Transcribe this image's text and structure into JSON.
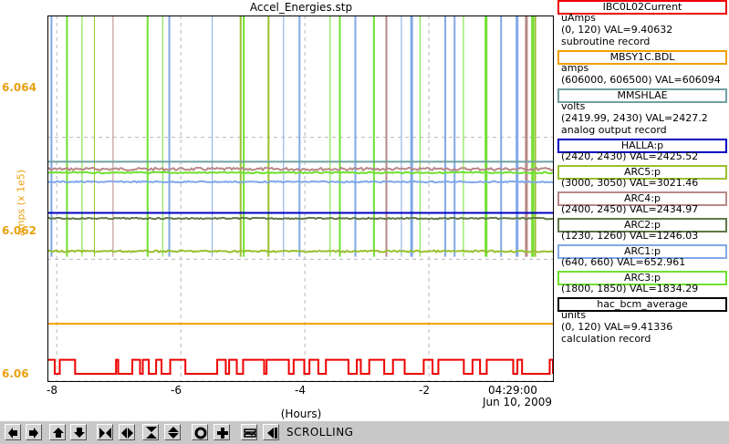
{
  "window": {
    "title": "Accel_Energies.stp"
  },
  "plot": {
    "y_axis_label": "amps (x 1e5)",
    "y_ticks": [
      "6.064",
      "6.062",
      "6.06"
    ],
    "x_ticks": [
      "-8",
      "-6",
      "-4",
      "-2"
    ],
    "x_time_label": "04:29:00",
    "x_date_label": "Jun 10, 2009",
    "x_axis_label": "(Hours)",
    "axis_color": "#e8a010"
  },
  "legend": [
    {
      "name": "IBC0L02Current",
      "color": "#ee0000",
      "lines": [
        "uAmps",
        "(0, 120) VAL=9.40632",
        "subroutine record"
      ]
    },
    {
      "name": "MBSY1C.BDL",
      "color": "#f0a000",
      "lines": [
        "amps",
        "(606000, 606500) VAL=606094"
      ]
    },
    {
      "name": "MMSHLAE",
      "color": "#70a0a0",
      "lines": [
        "volts",
        "(2419.99, 2430) VAL=2427.2",
        "analog output record"
      ]
    },
    {
      "name": "HALLA:p",
      "color": "#0000c0",
      "lines": [
        "(2420, 2430) VAL=2425.52"
      ]
    },
    {
      "name": "ARC5:p",
      "color": "#98c030",
      "lines": [
        "(3000, 3050) VAL=3021.46"
      ]
    },
    {
      "name": "ARC4:p",
      "color": "#b88888",
      "lines": [
        "(2400, 2450) VAL=2434.97"
      ]
    },
    {
      "name": "ARC2:p",
      "color": "#607848",
      "lines": [
        "(1230, 1260) VAL=1246.03"
      ]
    },
    {
      "name": "ARC1:p",
      "color": "#80a8e8",
      "lines": [
        "(640, 660) VAL=652.961"
      ]
    },
    {
      "name": "ARC3:p",
      "color": "#70e030",
      "lines": [
        "(1800, 1850) VAL=1834.29"
      ]
    },
    {
      "name": "hac_bcm_average",
      "color": "#000000",
      "lines": [
        "units",
        "(0, 120) VAL=9.41336",
        "calculation record"
      ]
    }
  ],
  "toolbar": {
    "buttons": [
      "pan-left-icon",
      "pan-right-icon",
      "pan-up-icon",
      "pan-down-icon",
      "zoom-in-x-icon",
      "zoom-out-x-icon",
      "zoom-in-y-icon",
      "zoom-out-y-icon",
      "auto-scale-icon",
      "reset-zoom-icon",
      "scroll-toggle-icon",
      "jump-to-end-icon"
    ],
    "mode_label": "SCROLLING"
  },
  "chart_data": {
    "type": "line",
    "title": "Accel_Energies.stp",
    "xlabel": "(Hours)",
    "ylabel": "amps (x 1e5)",
    "xlim": [
      -8.15,
      0
    ],
    "ylim": [
      6.06,
      6.066
    ],
    "x_ticks": [
      -8,
      -6,
      -4,
      -2
    ],
    "y_ticks": [
      6.06,
      6.062,
      6.064
    ],
    "grid": true,
    "series": [
      {
        "name": "MBSY1C.BDL",
        "color": "#f0a000",
        "values": [
          [
            -8.15,
            6.06094
          ],
          [
            0,
            6.06094
          ]
        ]
      },
      {
        "name": "MMSHLAE",
        "color": "#70a0a0",
        "values": [
          [
            -8.15,
            6.0636
          ],
          [
            0,
            6.0636
          ]
        ]
      },
      {
        "name": "HALLA:p",
        "color": "#0000c0",
        "values": [
          [
            -8.15,
            6.06276
          ],
          [
            0,
            6.06276
          ]
        ]
      },
      {
        "name": "ARC4:p",
        "color": "#b88888",
        "values": [
          [
            -8.15,
            6.06348
          ],
          [
            0,
            6.06348
          ]
        ]
      },
      {
        "name": "ARC3:p",
        "color": "#70e030",
        "values": [
          [
            -8.15,
            6.06342
          ],
          [
            0,
            6.06342
          ]
        ]
      },
      {
        "name": "ARC1:p",
        "color": "#80a8e8",
        "values": [
          [
            -8.15,
            6.06327
          ],
          [
            0,
            6.06327
          ]
        ]
      },
      {
        "name": "ARC2:p",
        "color": "#607848",
        "values": [
          [
            -8.15,
            6.06267
          ],
          [
            0,
            6.06267
          ]
        ]
      },
      {
        "name": "ARC5:p",
        "color": "#98c030",
        "values": [
          [
            -8.15,
            6.06213
          ],
          [
            0,
            6.06213
          ]
        ]
      },
      {
        "name": "IBC0L02Current",
        "color": "#ee0000",
        "values": [
          [
            -8.15,
            6.06035
          ],
          [
            0,
            6.06035
          ]
        ]
      }
    ]
  }
}
